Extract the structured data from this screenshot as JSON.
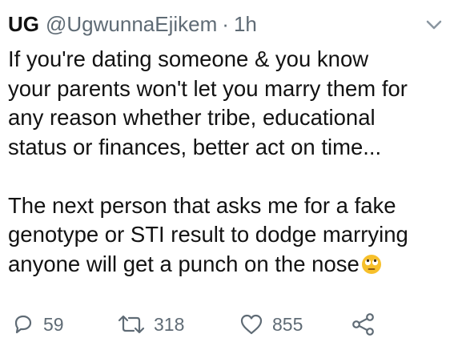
{
  "tweet": {
    "display_name": "UG",
    "handle": "@UgwunnaEjikem",
    "separator": "·",
    "time": "1h",
    "lines": [
      "If you're dating someone & you know",
      "your parents won't let you marry them for",
      "any reason whether tribe, educational",
      "status or finances, better act on time..."
    ],
    "lines2": [
      "The next person that asks me for a fake",
      "genotype or STI result to dodge marrying",
      "anyone will get a punch on the nose"
    ],
    "emoji": "rolling-eyes-emoji"
  },
  "actions": {
    "replies": "59",
    "retweets": "318",
    "likes": "855"
  },
  "icons": {
    "reply": "reply-icon",
    "retweet": "retweet-icon",
    "like": "heart-icon",
    "share": "share-icon",
    "menu": "chevron-down-icon"
  },
  "colors": {
    "text": "#121212",
    "secondary": "#5f6b75",
    "emoji": "#f7c02b"
  }
}
